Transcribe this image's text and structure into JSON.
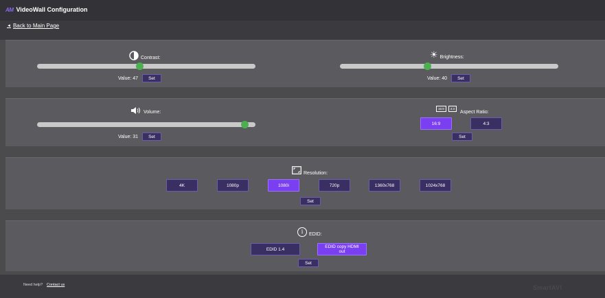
{
  "header": {
    "logo": "AM",
    "title": "VideoWall Configuration"
  },
  "nav": {
    "back_arrow": "◄",
    "back_label": "Back to Main Page"
  },
  "contrast": {
    "label": "Contrast:",
    "value_label": "Value: 47",
    "value": 47,
    "set_label": "Set"
  },
  "brightness": {
    "label": "Brightness:",
    "value_label": "Value: 40",
    "value": 40,
    "set_label": "Set"
  },
  "volume": {
    "label": "Volume:",
    "value_label": "Value: 31",
    "value": 31,
    "set_label": "Set"
  },
  "aspect": {
    "label": "Aspect Ratio:",
    "icon_a": "16:9",
    "icon_b": "4:3",
    "options": [
      "16:9",
      "4:3"
    ],
    "selected": "16:9",
    "set_label": "Set"
  },
  "resolution": {
    "label": "Resolution:",
    "options": [
      "4K",
      "1080p",
      "1080i",
      "720p",
      "1360x768",
      "1024x768"
    ],
    "selected": "1080i",
    "set_label": "Set"
  },
  "edid": {
    "label": "EDID:",
    "icon_glyph": "i",
    "options": [
      "EDID 1.4",
      "EDID copy HDMI out"
    ],
    "selected": "EDID copy HDMI out",
    "set_label": "Set"
  },
  "footer": {
    "help": "Need help?",
    "contact": "Contact us",
    "brand": "SmartAVI"
  },
  "colors": {
    "accent": "#7b3ff2",
    "button": "#3a2f63",
    "knob": "#4caf50",
    "panel": "#5b5a5e"
  }
}
